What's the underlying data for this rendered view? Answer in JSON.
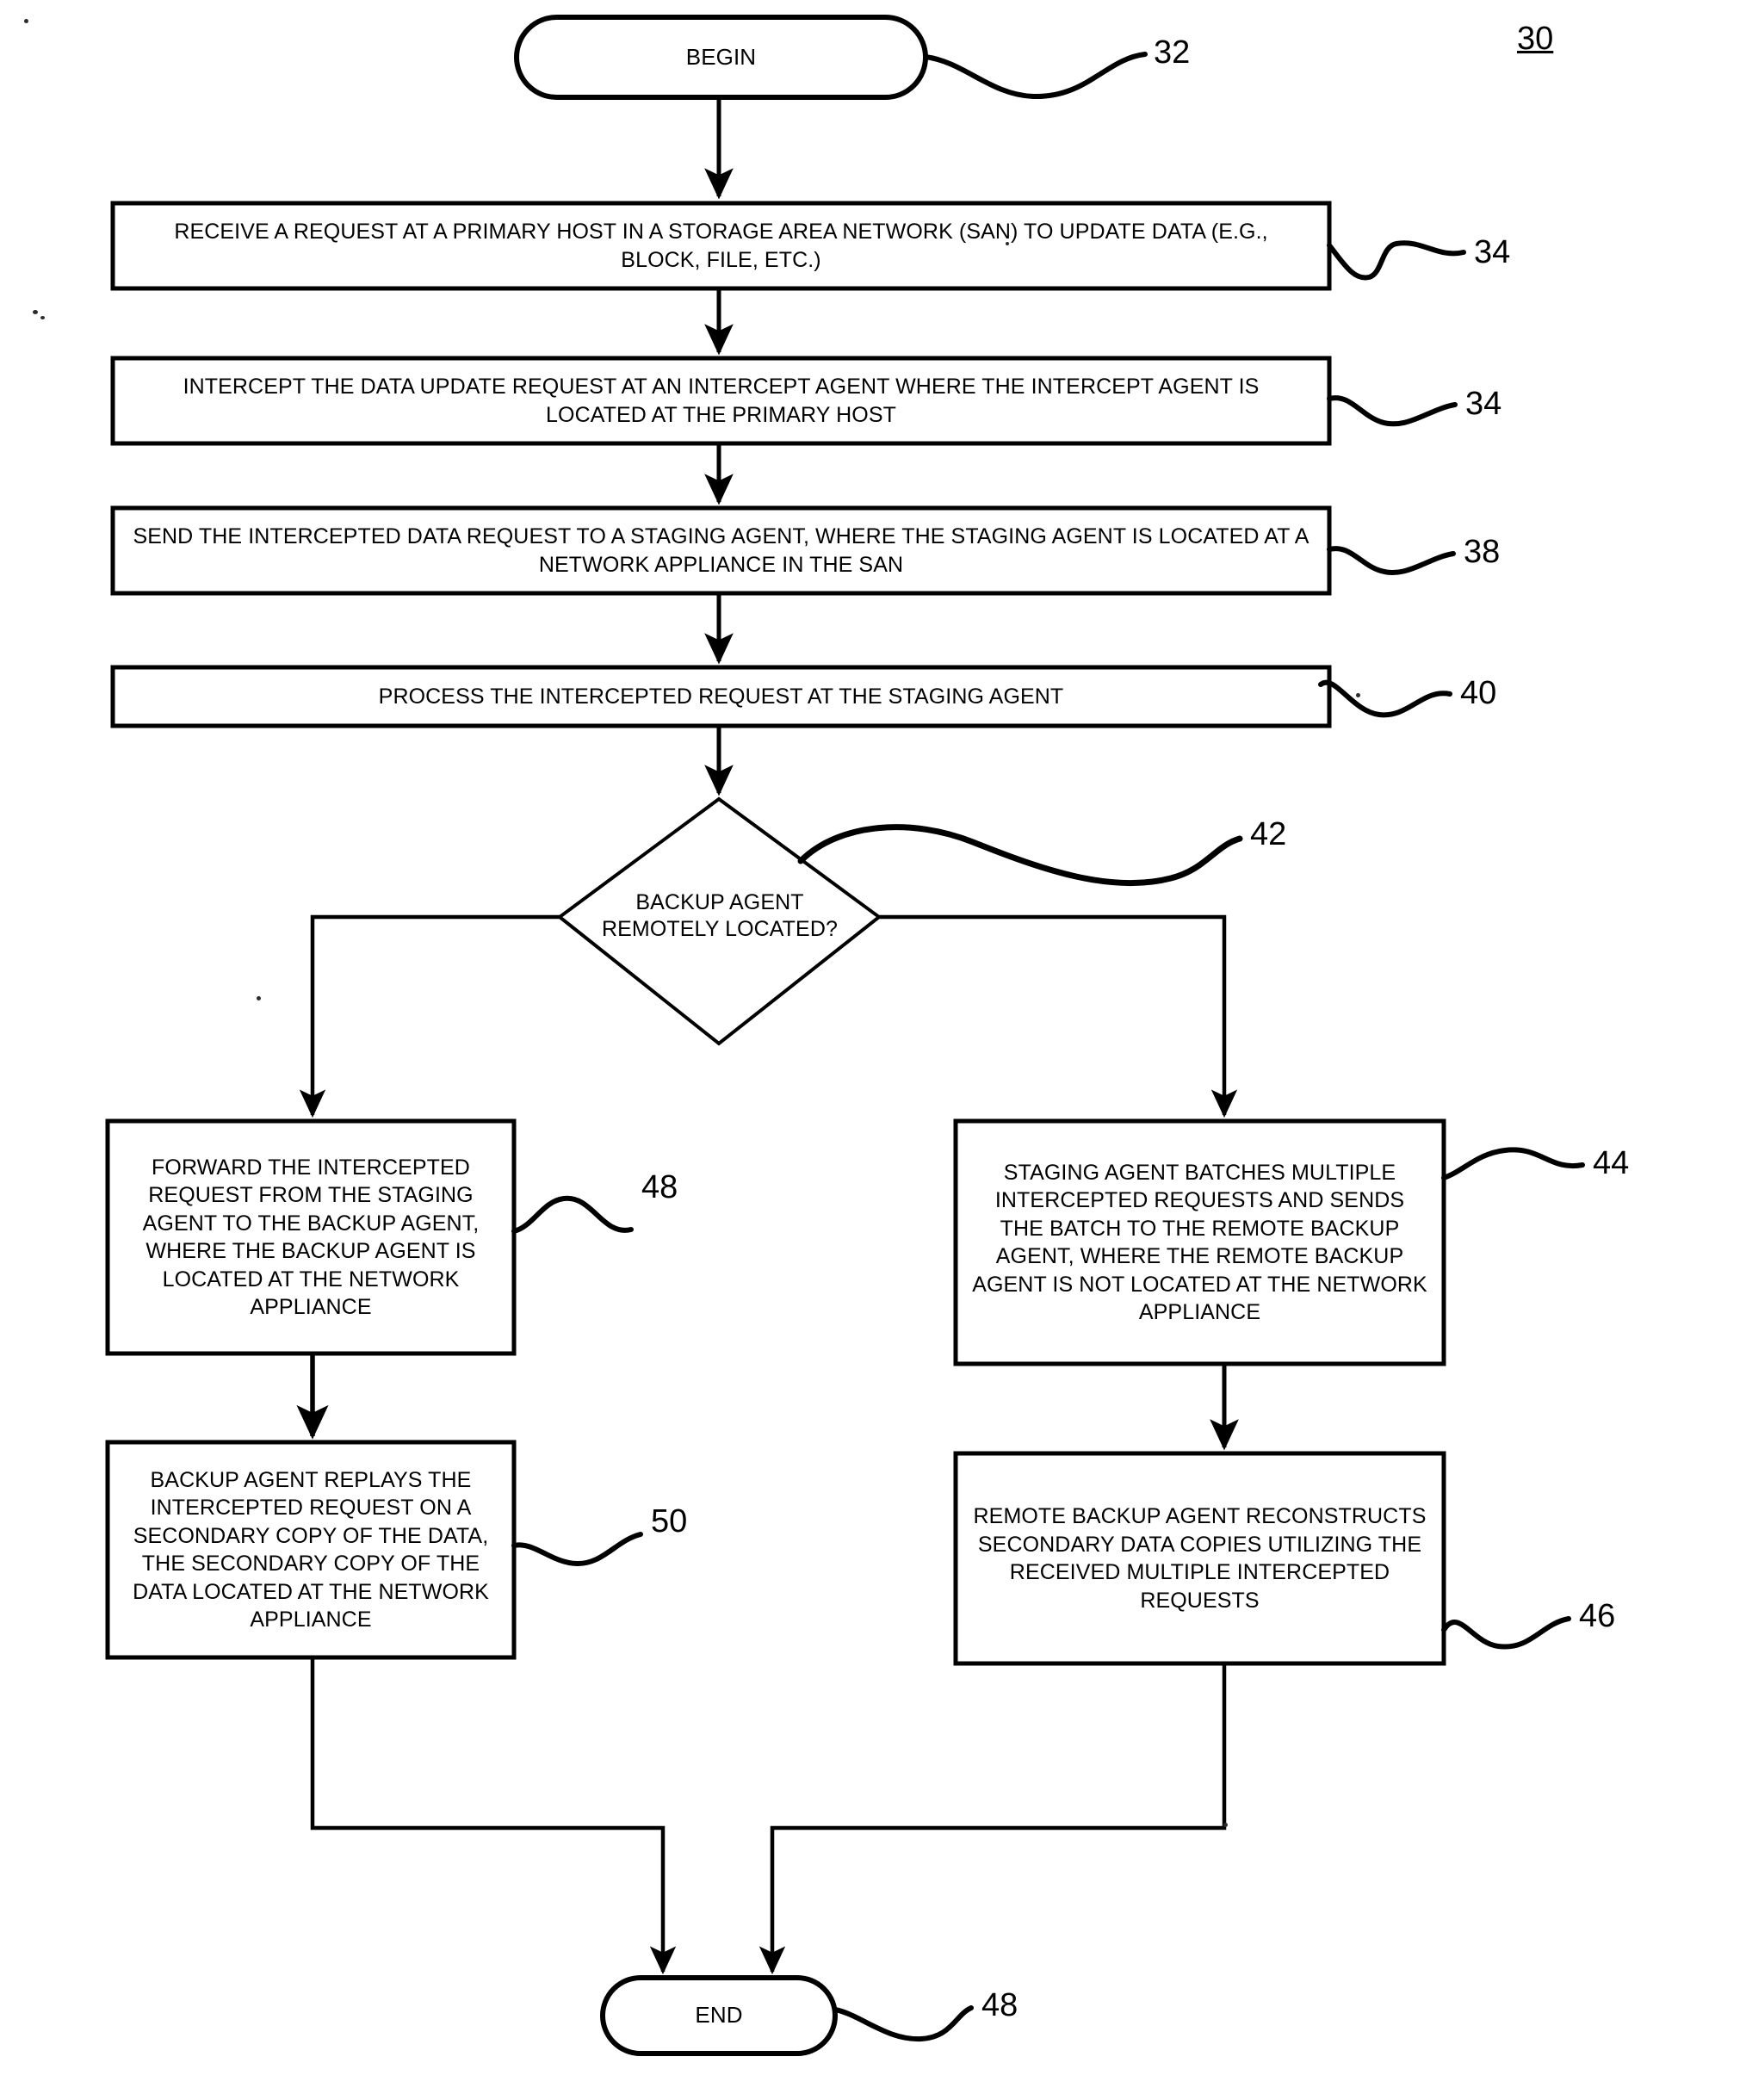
{
  "figure": {
    "number": "30",
    "title_ref": "30"
  },
  "nodes": {
    "begin": {
      "label": "BEGIN",
      "ref": "32",
      "shape": "terminator"
    },
    "step1": {
      "label": "RECEIVE A REQUEST AT A PRIMARY HOST IN A STORAGE AREA NETWORK (SAN) TO UPDATE DATA (E.G., BLOCK, FILE, ETC.)",
      "ref": "34",
      "shape": "process"
    },
    "step2": {
      "label": "INTERCEPT THE DATA UPDATE REQUEST AT AN INTERCEPT AGENT WHERE THE INTERCEPT AGENT IS LOCATED AT THE PRIMARY HOST",
      "ref": "34",
      "shape": "process"
    },
    "step3": {
      "label": "SEND THE INTERCEPTED DATA REQUEST TO A STAGING AGENT, WHERE THE STAGING AGENT IS LOCATED AT A NETWORK APPLIANCE IN THE SAN",
      "ref": "38",
      "shape": "process"
    },
    "step4": {
      "label": "PROCESS THE INTERCEPTED REQUEST AT THE STAGING AGENT",
      "ref": "40",
      "shape": "process"
    },
    "decision": {
      "label": "BACKUP AGENT REMOTELY LOCATED?",
      "ref": "42",
      "shape": "decision"
    },
    "left1": {
      "label": "FORWARD THE INTERCEPTED REQUEST FROM THE STAGING AGENT TO THE BACKUP AGENT, WHERE THE BACKUP AGENT IS LOCATED AT THE NETWORK APPLIANCE",
      "ref": "48",
      "shape": "process"
    },
    "left2": {
      "label": "BACKUP AGENT REPLAYS THE INTERCEPTED REQUEST ON A SECONDARY COPY OF THE DATA, THE SECONDARY COPY OF THE DATA LOCATED AT THE NETWORK APPLIANCE",
      "ref": "50",
      "shape": "process"
    },
    "right1": {
      "label": "STAGING AGENT BATCHES MULTIPLE INTERCEPTED REQUESTS AND SENDS THE BATCH TO THE REMOTE BACKUP AGENT, WHERE THE REMOTE BACKUP AGENT IS NOT LOCATED AT THE NETWORK APPLIANCE",
      "ref": "44",
      "shape": "process"
    },
    "right2": {
      "label": "REMOTE BACKUP AGENT RECONSTRUCTS SECONDARY DATA COPIES UTILIZING THE RECEIVED MULTIPLE INTERCEPTED REQUESTS",
      "ref": "46",
      "shape": "process"
    },
    "end": {
      "label": "END",
      "ref": "48",
      "shape": "terminator"
    }
  },
  "colors": {
    "stroke": "#000000",
    "background": "#ffffff",
    "text": "#000000"
  }
}
